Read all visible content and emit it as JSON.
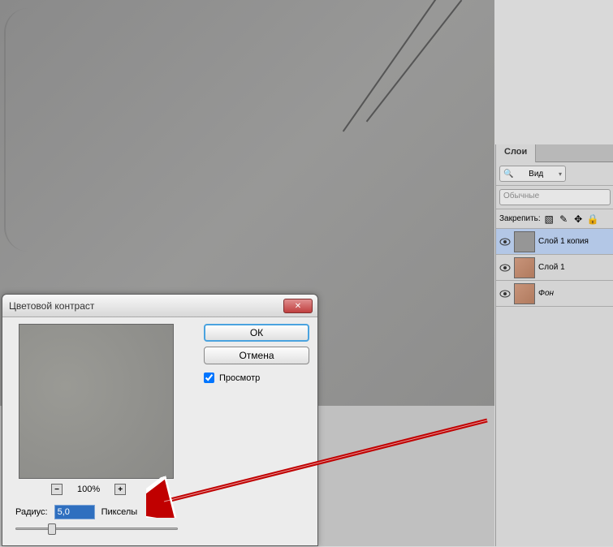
{
  "canvas": {},
  "layers_panel": {
    "tab": "Слои",
    "filter_label": "Вид",
    "blend_mode": "Обычные",
    "lock_label": "Закрепить:",
    "layers": [
      {
        "name": "Слой 1 копия",
        "selected": true,
        "thumb": "gray"
      },
      {
        "name": "Слой 1",
        "selected": false,
        "thumb": "skin"
      },
      {
        "name": "Фон",
        "selected": false,
        "thumb": "skin",
        "italic": true
      }
    ]
  },
  "dialog": {
    "title": "Цветовой контраст",
    "ok": "ОК",
    "cancel": "Отмена",
    "preview_checkbox": "Просмотр",
    "zoom_percent": "100%",
    "radius_label": "Радиус:",
    "radius_value": "5,0",
    "radius_unit": "Пикселы"
  }
}
